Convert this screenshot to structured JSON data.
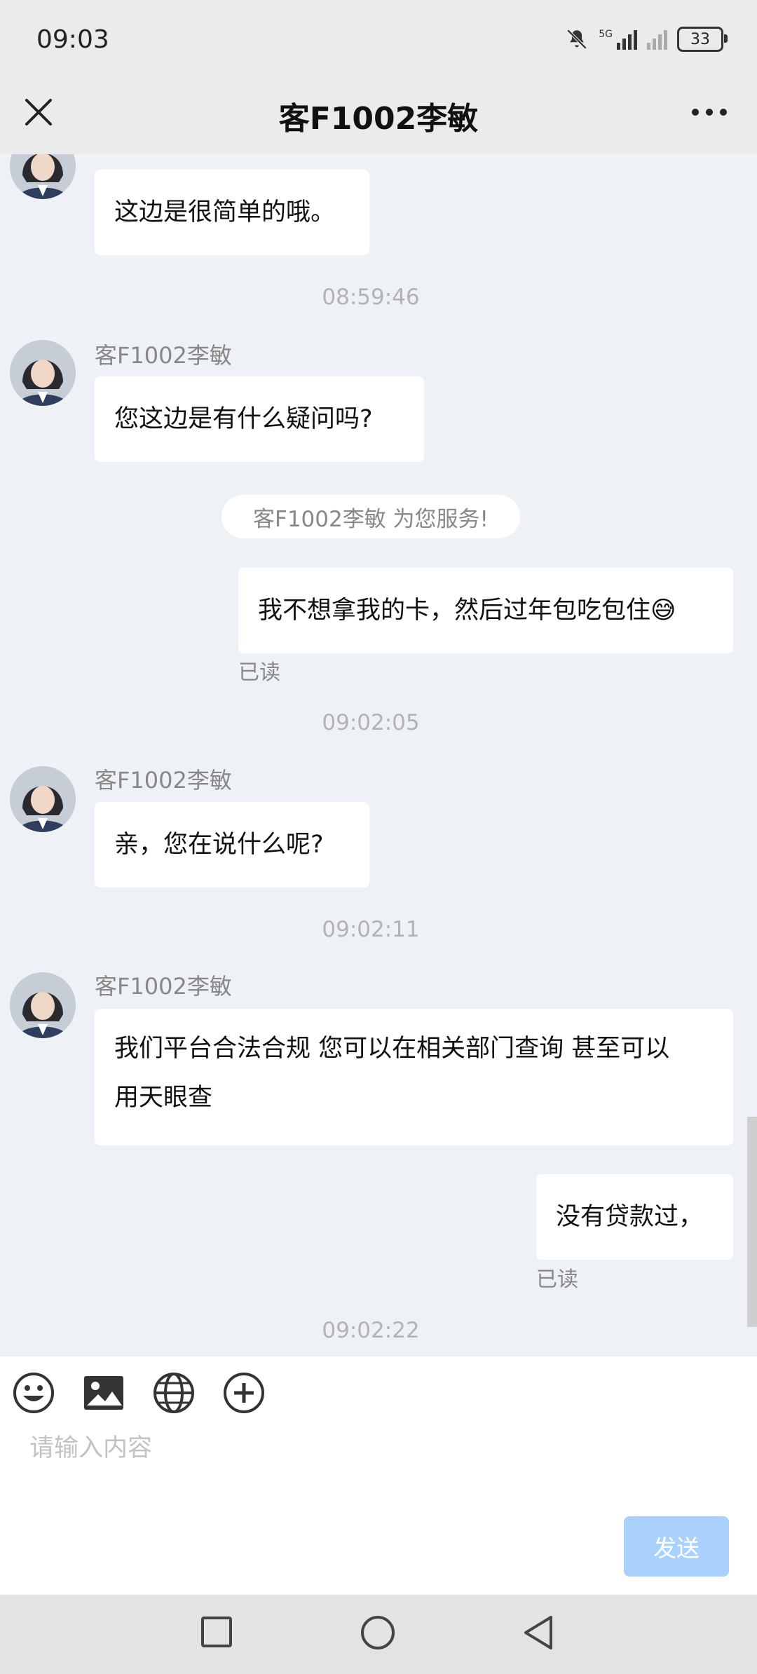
{
  "status": {
    "time": "09:03",
    "battery": "33",
    "network_label": "5G"
  },
  "header": {
    "title": "客F1002李敏"
  },
  "messages": {
    "m1": {
      "sender": "客F1002李敏",
      "text": "这边是很简单的哦。"
    },
    "ts1": "08:59:46",
    "m2": {
      "sender": "客F1002李敏",
      "text": "您这边是有什么疑问吗?"
    },
    "system_note": "客F1002李敏 为您服务!",
    "m3": {
      "text": "我不想拿我的卡，然后过年包吃包住😅",
      "read": "已读"
    },
    "ts2": "09:02:05",
    "m4": {
      "sender": "客F1002李敏",
      "text": "亲，您在说什么呢?"
    },
    "ts3": "09:02:11",
    "m5": {
      "sender": "客F1002李敏",
      "text_line1": "我们平台合法合规 您可以在相关部门查询 甚至可以",
      "text_line2": "用天眼查"
    },
    "m6": {
      "text": "没有贷款过，",
      "read": "已读"
    },
    "ts4": "09:02:22"
  },
  "composer": {
    "placeholder": "请输入内容",
    "send_label": "发送",
    "tools": [
      "emoji-icon",
      "image-icon",
      "globe-icon",
      "plus-circle-icon"
    ]
  },
  "colors": {
    "send_button": "#a9d1fb",
    "chat_bg": "#eef1f5",
    "header_bg": "#ebebeb"
  }
}
